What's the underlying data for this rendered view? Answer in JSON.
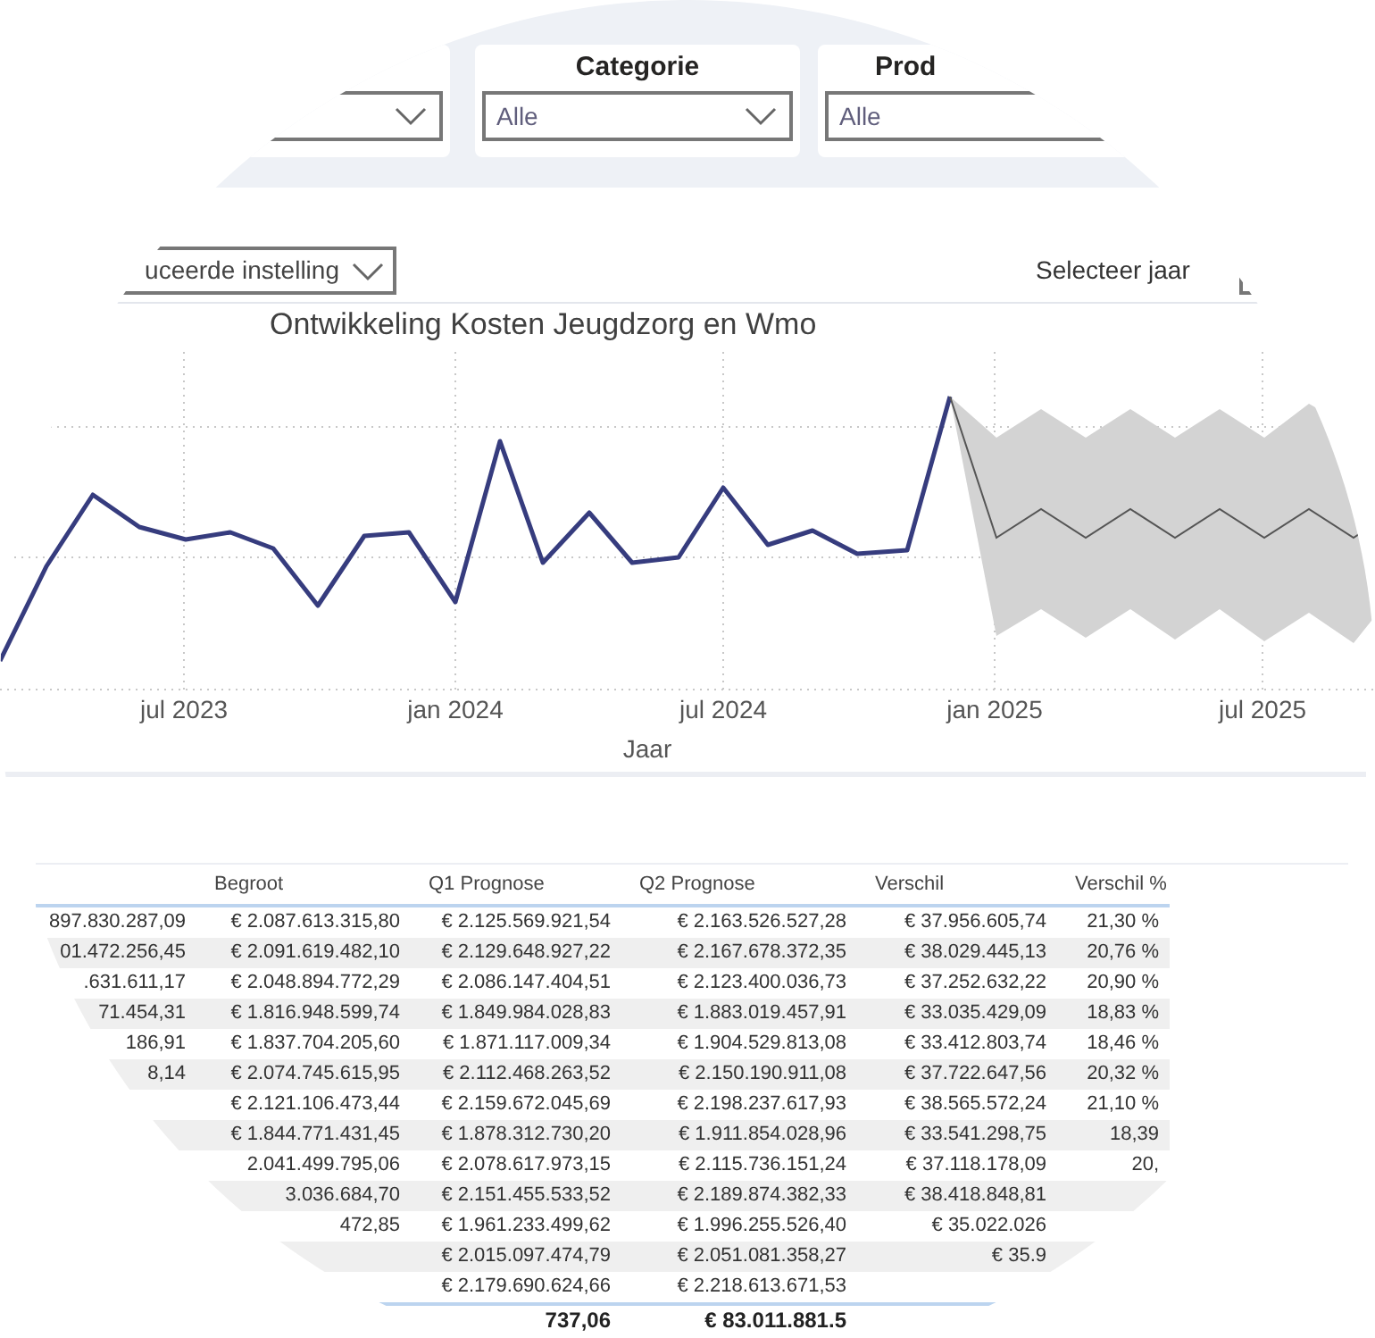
{
  "filters": [
    {
      "title": "Categorie",
      "value": "Alle"
    },
    {
      "title": "Prod",
      "value": "Alle"
    }
  ],
  "view_dropdown": {
    "value": "uceerde instelling"
  },
  "year_selector": {
    "label": "Selecteer jaar"
  },
  "chart": {
    "title": "Ontwikkeling Kosten Jeugdzorg en Wmo",
    "xlabel": "Jaar",
    "xticks": [
      "jul 2023",
      "jan 2024",
      "jul 2024",
      "jan 2025",
      "jul 2025"
    ]
  },
  "table": {
    "headers": [
      "Begroot",
      "Q1 Prognose",
      "Q2 Prognose",
      "Verschil",
      "Verschil %"
    ],
    "rows": [
      {
        "column_1": "897.830.287,09",
        "begroot": "€ 2.087.613.315,80",
        "q1_prognose": "€ 2.125.569.921,54",
        "q2_prognose": "€ 2.163.526.527,28",
        "verschil": "€ 37.956.605,74",
        "verschil_pct": "21,30 %"
      },
      {
        "column_1": "01.472.256,45",
        "begroot": "€ 2.091.619.482,10",
        "q1_prognose": "€ 2.129.648.927,22",
        "q2_prognose": "€ 2.167.678.372,35",
        "verschil": "€ 38.029.445,13",
        "verschil_pct": "20,76 %"
      },
      {
        "column_1": ".631.611,17",
        "begroot": "€ 2.048.894.772,29",
        "q1_prognose": "€ 2.086.147.404,51",
        "q2_prognose": "€ 2.123.400.036,73",
        "verschil": "€ 37.252.632,22",
        "verschil_pct": "20,90 %"
      },
      {
        "column_1": "71.454,31",
        "begroot": "€ 1.816.948.599,74",
        "q1_prognose": "€ 1.849.984.028,83",
        "q2_prognose": "€ 1.883.019.457,91",
        "verschil": "€ 33.035.429,09",
        "verschil_pct": "18,83 %"
      },
      {
        "column_1": "186,91",
        "begroot": "€ 1.837.704.205,60",
        "q1_prognose": "€ 1.871.117.009,34",
        "q2_prognose": "€ 1.904.529.813,08",
        "verschil": "€ 33.412.803,74",
        "verschil_pct": "18,46 %"
      },
      {
        "column_1": "8,14",
        "begroot": "€ 2.074.745.615,95",
        "q1_prognose": "€ 2.112.468.263,52",
        "q2_prognose": "€ 2.150.190.911,08",
        "verschil": "€ 37.722.647,56",
        "verschil_pct": "20,32 %"
      },
      {
        "begroot": "€ 2.121.106.473,44",
        "q1_prognose": "€ 2.159.672.045,69",
        "q2_prognose": "€ 2.198.237.617,93",
        "verschil": "€ 38.565.572,24",
        "verschil_pct": "21,10 %"
      },
      {
        "begroot": "€ 1.844.771.431,45",
        "q1_prognose": "€ 1.878.312.730,20",
        "q2_prognose": "€ 1.911.854.028,96",
        "verschil": "€ 33.541.298,75",
        "verschil_pct": "18,39"
      },
      {
        "begroot": "2.041.499.795,06",
        "q1_prognose": "€ 2.078.617.973,15",
        "q2_prognose": "€ 2.115.736.151,24",
        "verschil": "€ 37.118.178,09",
        "verschil_pct": "20,"
      },
      {
        "begroot": "3.036.684,70",
        "q1_prognose": "€ 2.151.455.533,52",
        "q2_prognose": "€ 2.189.874.382,33",
        "verschil": "€ 38.418.848,81"
      },
      {
        "begroot": "472,85",
        "q1_prognose": "€ 1.961.233.499,62",
        "q2_prognose": "€ 1.996.255.526,40",
        "verschil": "€ 35.022.026"
      },
      {
        "q1_prognose": "€ 2.015.097.474,79",
        "q2_prognose": "€ 2.051.081.358,27",
        "verschil": "€ 35.9"
      },
      {
        "q1_prognose": "€ 2.179.690.624,66",
        "q2_prognose": "€ 2.218.613.671,53"
      }
    ],
    "total": {
      "q1_prognose": "737,06",
      "q2_prognose": "€ 83.011.881.5"
    }
  }
}
